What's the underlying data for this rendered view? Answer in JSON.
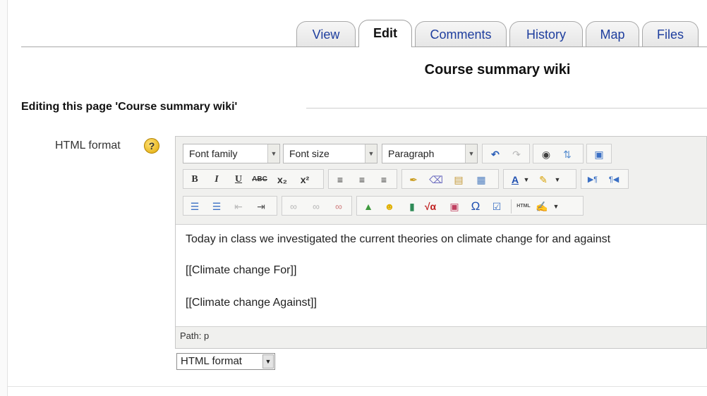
{
  "tabs": [
    {
      "label": "View"
    },
    {
      "label": "Edit",
      "active": true
    },
    {
      "label": "Comments"
    },
    {
      "label": "History"
    },
    {
      "label": "Map"
    },
    {
      "label": "Files"
    }
  ],
  "page_title": "Course summary wiki",
  "form": {
    "legend": "Editing this page 'Course summary wiki'",
    "field_label": "HTML format",
    "help_glyph": "?"
  },
  "editor": {
    "font_family": "Font family",
    "font_size": "Font size",
    "block_format": "Paragraph",
    "content": [
      "Today in class we investigated the current theories on climate change for and against",
      "[[Climate change For]]",
      "[[Climate change Against]]"
    ],
    "path": "Path: p"
  },
  "format_select": {
    "value": "HTML format"
  },
  "colors": {
    "tab_link": "#1e3e9e",
    "editor_bg": "#f0f0ee",
    "help_icon": "#e0a800"
  },
  "toolbar_icons": [
    "undo-icon",
    "redo-icon",
    "find-icon",
    "replace-icon",
    "fullscreen-icon",
    "bold-icon",
    "italic-icon",
    "underline-icon",
    "strikethrough-icon",
    "subscript-icon",
    "superscript-icon",
    "align-left-icon",
    "align-center-icon",
    "align-right-icon",
    "cleanup-icon",
    "remove-format-icon",
    "paste-text-icon",
    "paste-word-icon",
    "text-color-icon",
    "highlight-color-icon",
    "ltr-icon",
    "rtl-icon",
    "bullet-list-icon",
    "numbered-list-icon",
    "outdent-icon",
    "indent-icon",
    "link-icon",
    "unlink-icon",
    "wiki-link-icon",
    "image-icon",
    "emoticon-icon",
    "bookmark-icon",
    "math-icon",
    "media-icon",
    "special-char-icon",
    "spellcheck-toggle-icon",
    "html-source-icon",
    "spellcheck-icon"
  ]
}
